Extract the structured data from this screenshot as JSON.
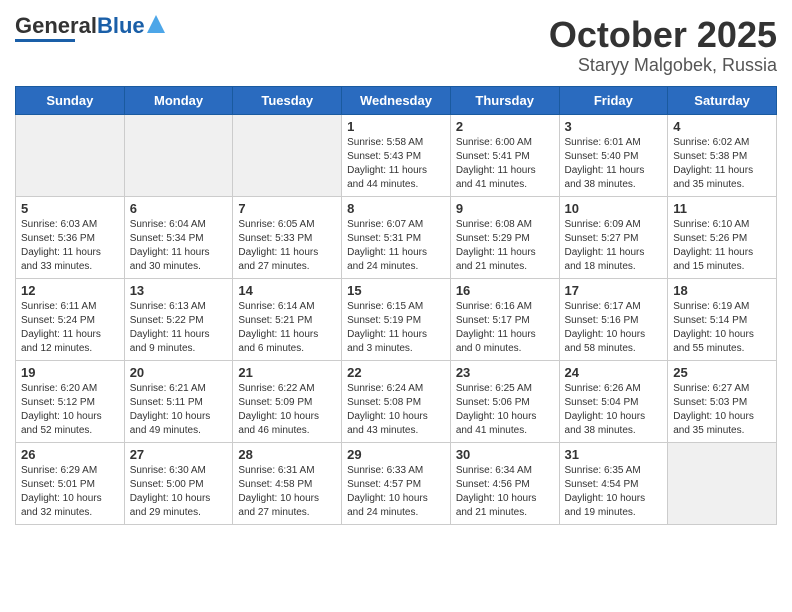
{
  "header": {
    "logo_general": "General",
    "logo_blue": "Blue",
    "title": "October 2025",
    "subtitle": "Staryy Malgobek, Russia"
  },
  "weekdays": [
    "Sunday",
    "Monday",
    "Tuesday",
    "Wednesday",
    "Thursday",
    "Friday",
    "Saturday"
  ],
  "weeks": [
    [
      {
        "day": "",
        "info": ""
      },
      {
        "day": "",
        "info": ""
      },
      {
        "day": "",
        "info": ""
      },
      {
        "day": "1",
        "info": "Sunrise: 5:58 AM\nSunset: 5:43 PM\nDaylight: 11 hours\nand 44 minutes."
      },
      {
        "day": "2",
        "info": "Sunrise: 6:00 AM\nSunset: 5:41 PM\nDaylight: 11 hours\nand 41 minutes."
      },
      {
        "day": "3",
        "info": "Sunrise: 6:01 AM\nSunset: 5:40 PM\nDaylight: 11 hours\nand 38 minutes."
      },
      {
        "day": "4",
        "info": "Sunrise: 6:02 AM\nSunset: 5:38 PM\nDaylight: 11 hours\nand 35 minutes."
      }
    ],
    [
      {
        "day": "5",
        "info": "Sunrise: 6:03 AM\nSunset: 5:36 PM\nDaylight: 11 hours\nand 33 minutes."
      },
      {
        "day": "6",
        "info": "Sunrise: 6:04 AM\nSunset: 5:34 PM\nDaylight: 11 hours\nand 30 minutes."
      },
      {
        "day": "7",
        "info": "Sunrise: 6:05 AM\nSunset: 5:33 PM\nDaylight: 11 hours\nand 27 minutes."
      },
      {
        "day": "8",
        "info": "Sunrise: 6:07 AM\nSunset: 5:31 PM\nDaylight: 11 hours\nand 24 minutes."
      },
      {
        "day": "9",
        "info": "Sunrise: 6:08 AM\nSunset: 5:29 PM\nDaylight: 11 hours\nand 21 minutes."
      },
      {
        "day": "10",
        "info": "Sunrise: 6:09 AM\nSunset: 5:27 PM\nDaylight: 11 hours\nand 18 minutes."
      },
      {
        "day": "11",
        "info": "Sunrise: 6:10 AM\nSunset: 5:26 PM\nDaylight: 11 hours\nand 15 minutes."
      }
    ],
    [
      {
        "day": "12",
        "info": "Sunrise: 6:11 AM\nSunset: 5:24 PM\nDaylight: 11 hours\nand 12 minutes."
      },
      {
        "day": "13",
        "info": "Sunrise: 6:13 AM\nSunset: 5:22 PM\nDaylight: 11 hours\nand 9 minutes."
      },
      {
        "day": "14",
        "info": "Sunrise: 6:14 AM\nSunset: 5:21 PM\nDaylight: 11 hours\nand 6 minutes."
      },
      {
        "day": "15",
        "info": "Sunrise: 6:15 AM\nSunset: 5:19 PM\nDaylight: 11 hours\nand 3 minutes."
      },
      {
        "day": "16",
        "info": "Sunrise: 6:16 AM\nSunset: 5:17 PM\nDaylight: 11 hours\nand 0 minutes."
      },
      {
        "day": "17",
        "info": "Sunrise: 6:17 AM\nSunset: 5:16 PM\nDaylight: 10 hours\nand 58 minutes."
      },
      {
        "day": "18",
        "info": "Sunrise: 6:19 AM\nSunset: 5:14 PM\nDaylight: 10 hours\nand 55 minutes."
      }
    ],
    [
      {
        "day": "19",
        "info": "Sunrise: 6:20 AM\nSunset: 5:12 PM\nDaylight: 10 hours\nand 52 minutes."
      },
      {
        "day": "20",
        "info": "Sunrise: 6:21 AM\nSunset: 5:11 PM\nDaylight: 10 hours\nand 49 minutes."
      },
      {
        "day": "21",
        "info": "Sunrise: 6:22 AM\nSunset: 5:09 PM\nDaylight: 10 hours\nand 46 minutes."
      },
      {
        "day": "22",
        "info": "Sunrise: 6:24 AM\nSunset: 5:08 PM\nDaylight: 10 hours\nand 43 minutes."
      },
      {
        "day": "23",
        "info": "Sunrise: 6:25 AM\nSunset: 5:06 PM\nDaylight: 10 hours\nand 41 minutes."
      },
      {
        "day": "24",
        "info": "Sunrise: 6:26 AM\nSunset: 5:04 PM\nDaylight: 10 hours\nand 38 minutes."
      },
      {
        "day": "25",
        "info": "Sunrise: 6:27 AM\nSunset: 5:03 PM\nDaylight: 10 hours\nand 35 minutes."
      }
    ],
    [
      {
        "day": "26",
        "info": "Sunrise: 6:29 AM\nSunset: 5:01 PM\nDaylight: 10 hours\nand 32 minutes."
      },
      {
        "day": "27",
        "info": "Sunrise: 6:30 AM\nSunset: 5:00 PM\nDaylight: 10 hours\nand 29 minutes."
      },
      {
        "day": "28",
        "info": "Sunrise: 6:31 AM\nSunset: 4:58 PM\nDaylight: 10 hours\nand 27 minutes."
      },
      {
        "day": "29",
        "info": "Sunrise: 6:33 AM\nSunset: 4:57 PM\nDaylight: 10 hours\nand 24 minutes."
      },
      {
        "day": "30",
        "info": "Sunrise: 6:34 AM\nSunset: 4:56 PM\nDaylight: 10 hours\nand 21 minutes."
      },
      {
        "day": "31",
        "info": "Sunrise: 6:35 AM\nSunset: 4:54 PM\nDaylight: 10 hours\nand 19 minutes."
      },
      {
        "day": "",
        "info": ""
      }
    ]
  ]
}
